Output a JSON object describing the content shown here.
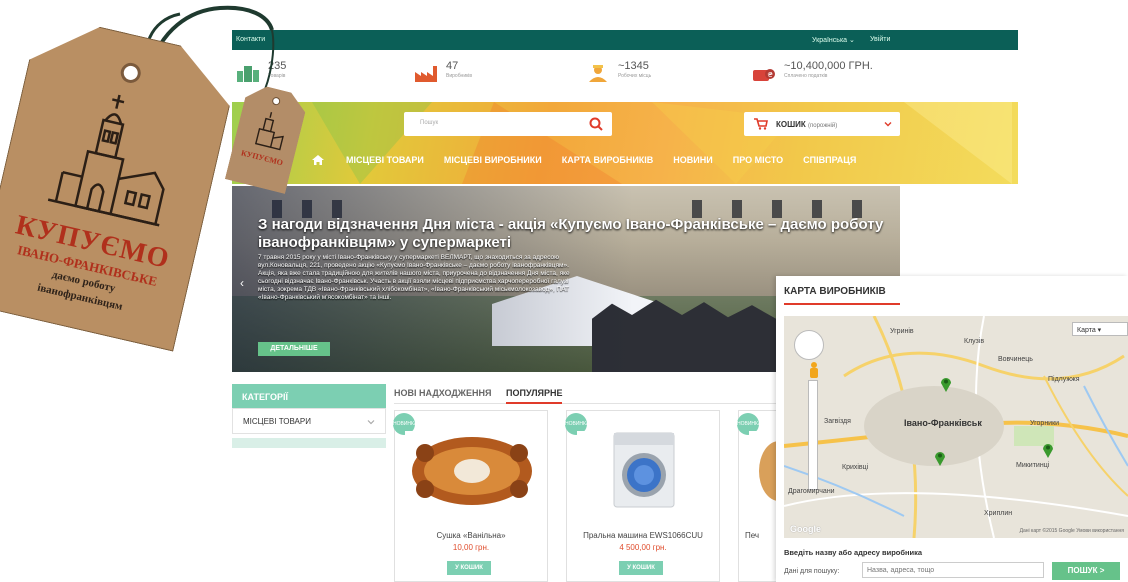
{
  "topbar": {
    "contacts": "Контакти",
    "language": "Українська",
    "login": "Увійти"
  },
  "stats": [
    {
      "value": "235",
      "label": "Товарів",
      "icon": "buildings-icon"
    },
    {
      "value": "47",
      "label": "Виробників",
      "icon": "factory-icon"
    },
    {
      "value": "~1345",
      "label": "Робочих місць",
      "icon": "worker-icon"
    },
    {
      "value": "~10,400,000 ГРН.",
      "label": "Сплачено податків",
      "icon": "money-icon"
    }
  ],
  "header": {
    "search_placeholder": "Пошук",
    "cart_label": "КОШИК",
    "cart_state": "(порожній)"
  },
  "nav": [
    "МІСЦЕВІ ТОВАРИ",
    "МІСЦЕВІ ВИРОБНИКИ",
    "КАРТА ВИРОБНИКІВ",
    "НОВИНИ",
    "ПРО МІСТО",
    "СПІВПРАЦЯ"
  ],
  "slide": {
    "title": "З нагоди відзначення Дня міста - акція «Купуємо Івано-Франківське – даємо роботу іванофранківцям» у супермаркеті",
    "text": "7 травня 2015 року у місті Івано-Франківську у супермаркеті ВЕЛМАРТ, що знаходиться за адресою вул.Коновальця, 221, проведено акцію «Купуємо Івано-Франківське – даємо роботу іванофранківцям». Акція, яка вже стала традиційною для жителів нашого міста, приурочена до відзначення Дня міста, яке сьогодні відзначає Івано-Франківськ. Участь в акції взяли місцеві підприємства харчопереробної галузі міста, зокрема ТДВ «Івано-Франківський хлібокомбінат», «Івано-Франківський міськмолокозавод», ПАТ «Івано-Франківський м'ясокомбінат» та інші.",
    "more": "ДЕТАЛЬНІШЕ"
  },
  "categories": {
    "title": "КАТЕГОРІЇ",
    "items": [
      "МІСЦЕВІ ТОВАРИ"
    ]
  },
  "tabs": [
    "НОВІ НАДХОДЖЕННЯ",
    "ПОПУЛЯРНЕ"
  ],
  "products": [
    {
      "badge": "НОВИНКА",
      "name": "Сушка «Ванільна»",
      "price": "10,00 грн.",
      "buy": "У КОШИК"
    },
    {
      "badge": "НОВИНКА",
      "name": "Пральна машина EWS1066CUU",
      "price": "4 500,00 грн.",
      "buy": "У КОШИК"
    },
    {
      "badge": "НОВИНКА",
      "name": "Печ",
      "price": "",
      "buy": ""
    }
  ],
  "tag": {
    "line1": "КУПУЄМО",
    "line2": "ІВАНО-ФРАНКІВСЬКЕ",
    "line3": "даємо роботу",
    "line4": "іванофранківцям",
    "small": "КУПУЄМО"
  },
  "map": {
    "title": "КАРТА ВИРОБНИКІВ",
    "map_type": "Карта",
    "labels": [
      "Угринів",
      "Клузів",
      "Вовчинець",
      "Підлужжя",
      "Іvaно-Франківськ",
      "Загвіздя",
      "Угорники",
      "Микитинці",
      "Крихівці",
      "Драгомирчани",
      "Хриплин",
      "Івано-Франківськ"
    ],
    "city": "Івано-Франківськ",
    "copyright": "Дані карт ©2015 Google   Умови використання",
    "hint": "Введіть назву або адресу виробника",
    "search_label": "Дані для пошуку:",
    "search_placeholder": "Назва, адреса, тощо",
    "search_button": "ПОШУК >"
  },
  "colors": {
    "teal": "#0b5f57",
    "mint": "#7ccfb2",
    "green": "#66c28a",
    "red": "#e03b2a",
    "kraft": "#b98f63"
  }
}
